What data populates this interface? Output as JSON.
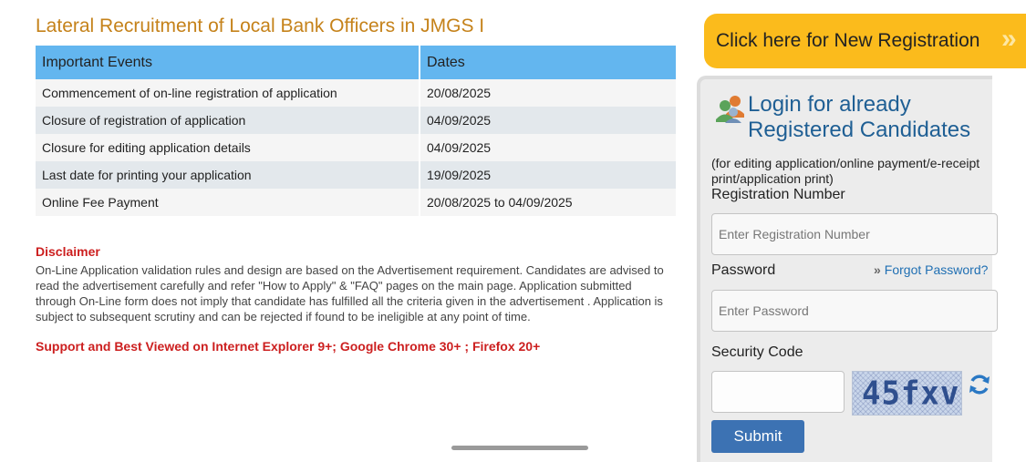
{
  "page": {
    "title": "Lateral Recruitment of Local Bank Officers in JMGS I"
  },
  "events_table": {
    "headers": [
      "Important Events",
      "Dates"
    ],
    "rows": [
      {
        "event": "Commencement of on-line registration of application",
        "date": "20/08/2025"
      },
      {
        "event": "Closure of registration of application",
        "date": "04/09/2025"
      },
      {
        "event": "Closure for editing application details",
        "date": "04/09/2025"
      },
      {
        "event": "Last date for printing your application",
        "date": "19/09/2025"
      },
      {
        "event": "Online Fee Payment",
        "date": "20/08/2025 to 04/09/2025"
      }
    ]
  },
  "disclaimer": {
    "title": "Disclaimer",
    "text": "On-Line Application validation rules and design are based on the Advertisement requirement. Candidates are advised to read the advertisement carefully and refer \"How to Apply\" & \"FAQ\" pages on the main page. Application submitted through On-Line form does not imply that candidate has fulfilled all the criteria given in the advertisement . Application is subject to subsequent scrutiny and can be rejected if found to be ineligible at any point of time.",
    "support": "Support and Best Viewed on Internet Explorer 9+; Google Chrome 30+ ; Firefox 20+"
  },
  "registration": {
    "label": "Click here for New Registration",
    "arrow_icon": "double-chevron-right-icon"
  },
  "login": {
    "icon": "users-group-icon",
    "heading": "Login for already Registered Candidates",
    "note": "(for editing application/online payment/e-receipt print/application print)",
    "reg_label": "Registration Number",
    "reg_placeholder": "Enter Registration Number",
    "password_label": "Password",
    "forgot_label": "Forgot Password?",
    "password_placeholder": "Enter Password",
    "security_label": "Security Code",
    "captcha_text": "45fxv",
    "refresh_icon": "refresh-icon",
    "submit_label": "Submit"
  },
  "colors": {
    "title": "#c5821a",
    "table_header": "#63b6ef",
    "alert_red": "#cc1f1f",
    "banner": "#fbbb1c",
    "login_heading": "#1f5f94",
    "submit": "#3c72b3"
  }
}
